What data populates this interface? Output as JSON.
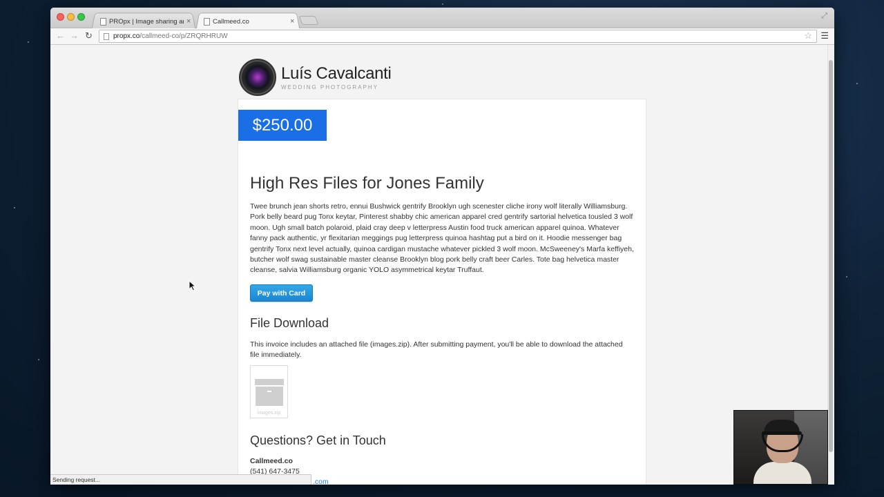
{
  "browser": {
    "tabs": [
      {
        "label": "PROpx | Image sharing an",
        "close": "×"
      },
      {
        "label": "Callmeed.co",
        "close": "×"
      }
    ],
    "url_host": "propx.co",
    "url_path": "/callmeed-co/p/ZRQRHRUW",
    "status_text": "Sending request..."
  },
  "brand": {
    "name": "Luís Cavalcanti",
    "tagline": "WEDDING PHOTOGRAPHY"
  },
  "invoice": {
    "price": "$250.00",
    "title": "High Res Files for Jones Family",
    "description": "Twee brunch jean shorts retro, ennui Bushwick gentrify Brooklyn ugh scenester cliche irony wolf literally Williamsburg. Pork belly beard pug Tonx keytar, Pinterest shabby chic american apparel cred gentrify sartorial helvetica tousled 3 wolf moon. Ugh small batch polaroid, plaid cray deep v letterpress Austin food truck american apparel quinoa. Whatever fanny pack authentic, yr flexitarian meggings pug letterpress quinoa hashtag put a bird on it. Hoodie messenger bag gentrify Tonx next level actually, quinoa cardigan mustache whatever pickled 3 wolf moon. McSweeney's Marfa keffiyeh, butcher wolf swag sustainable master cleanse Brooklyn blog pork belly craft beer Carles. Tote bag helvetica master cleanse, salvia Williamsburg organic YOLO asymmetrical keytar Truffaut.",
    "pay_button": "Pay with Card"
  },
  "file_download": {
    "heading": "File Download",
    "text": "This invoice includes an attached file (images.zip). After submitting payment, you'll be able to download the attached file immediately.",
    "file_name": "images.zip"
  },
  "contact": {
    "heading": "Questions? Get in Touch",
    "name": "Callmeed.co",
    "phone": "(541) 647-3475",
    "email_fragment": ".com"
  },
  "colors": {
    "price_bg": "#1a6ee6",
    "pay_button": "#1a86d1",
    "link": "#2a7ad0"
  },
  "icons": [
    "page-icon",
    "star-icon",
    "menu-icon",
    "back-icon",
    "forward-icon",
    "reload-icon",
    "box-icon",
    "resize-icon"
  ]
}
